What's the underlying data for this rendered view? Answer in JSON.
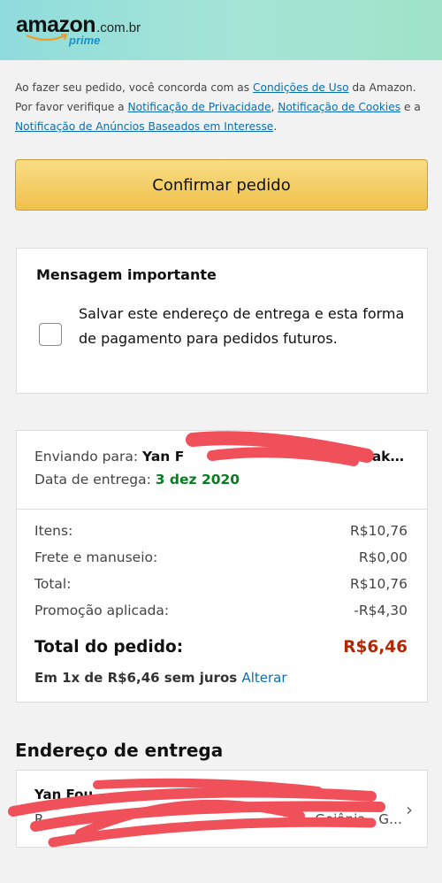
{
  "header": {
    "brand": "amazon",
    "tld": ".com.br",
    "prime": "prime"
  },
  "legal": {
    "t1": "Ao fazer seu pedido, você concorda com as ",
    "l1": "Condições de Uso",
    "t2": " da Amazon. Por favor verifique a ",
    "l2": "Notificação de Privacidade",
    "t3": ", ",
    "l3": "Notificação de Cookies",
    "t4": " e a ",
    "l4": "Notificação de Anúncios Baseados em Interesse",
    "t5": "."
  },
  "confirm_button": "Confirmar pedido",
  "message": {
    "title": "Mensagem importante",
    "checkbox_label": "Salvar este endereço de entrega e esta forma de pagamento para pedidos futuros."
  },
  "summary": {
    "ship_label": "Enviando para:",
    "ship_name": "Yan F",
    "ship_name_end": "Nak…",
    "date_label": "Data de entrega:",
    "date_value": "3 dez 2020",
    "items_label": "Itens:",
    "items_value": "R$10,76",
    "shipping_label": "Frete e manuseio:",
    "shipping_value": "R$0,00",
    "total_label": "Total:",
    "total_value": "R$10,76",
    "promo_label": "Promoção aplicada:",
    "promo_value": "-R$4,30",
    "order_total_label": "Total do pedido:",
    "order_total_value": "R$6,46",
    "installment_text": "Em 1x de R$6,46 sem juros",
    "change_link": "Alterar"
  },
  "address": {
    "title": "Endereço de entrega",
    "name": "Yan Fou",
    "line_start": "R",
    "line_end": ", Goiânia - G…"
  },
  "colors": {
    "accent_link": "#0a6fb0",
    "button_yellow": "#f0c14b",
    "delivery_green": "#067d1f",
    "price_red": "#b12704",
    "redaction": "#f0505a"
  }
}
